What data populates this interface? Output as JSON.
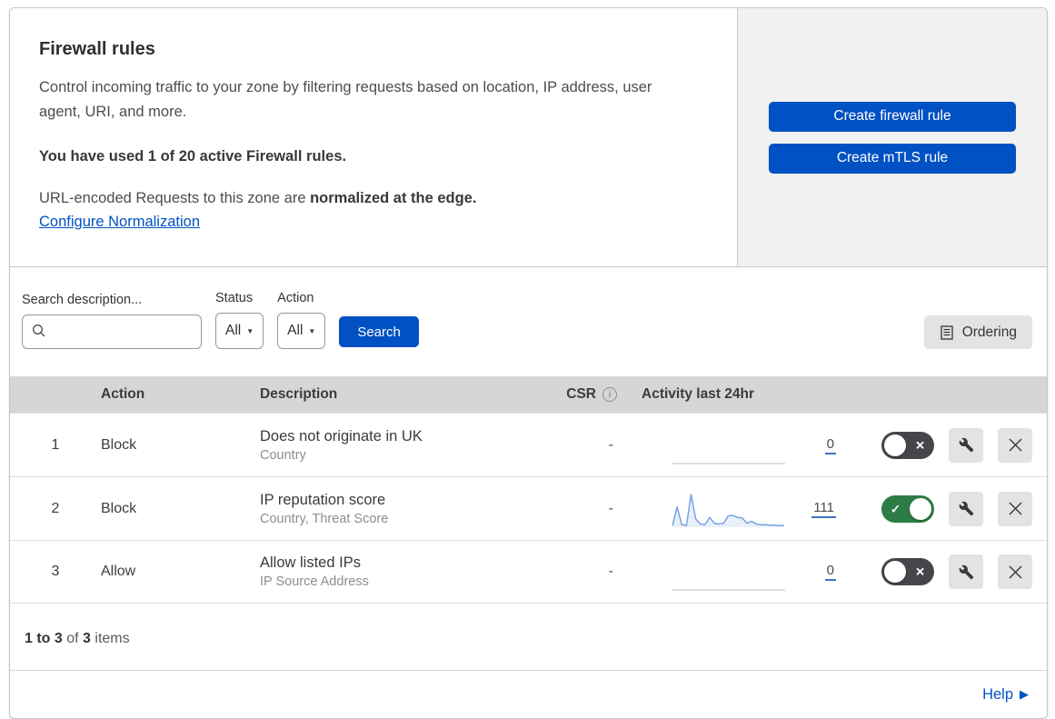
{
  "intro": {
    "title": "Firewall rules",
    "description": "Control incoming traffic to your zone by filtering requests based on location, IP address, user agent, URI, and more.",
    "usage": "You have used 1 of 20 active Firewall rules.",
    "normalization_prefix": "URL-encoded Requests to this zone are ",
    "normalization_bold": "normalized at the edge.",
    "normalization_link": "Configure Normalization"
  },
  "actions": {
    "create_firewall": "Create firewall rule",
    "create_mtls": "Create mTLS rule"
  },
  "filters": {
    "search_label": "Search description...",
    "search_value": "",
    "status_label": "Status",
    "status_value": "All",
    "action_label": "Action",
    "action_value": "All",
    "search_button": "Search",
    "ordering_button": "Ordering"
  },
  "table": {
    "headers": {
      "action": "Action",
      "description": "Description",
      "csr": "CSR",
      "activity": "Activity last 24hr"
    },
    "rows": [
      {
        "priority": "1",
        "action": "Block",
        "description": "Does not originate in UK",
        "fields": "Country",
        "csr": "-",
        "count": "0",
        "enabled": false,
        "sparkline": []
      },
      {
        "priority": "2",
        "action": "Block",
        "description": "IP reputation score",
        "fields": "Country, Threat Score",
        "csr": "-",
        "count": "111",
        "enabled": true,
        "sparkline": [
          5,
          62,
          8,
          5,
          100,
          25,
          10,
          8,
          30,
          12,
          10,
          12,
          35,
          36,
          30,
          28,
          12,
          18,
          10,
          7,
          8,
          6,
          6,
          5,
          5
        ]
      },
      {
        "priority": "3",
        "action": "Allow",
        "description": "Allow listed IPs",
        "fields": "IP Source Address",
        "csr": "-",
        "count": "0",
        "enabled": false,
        "sparkline": []
      }
    ]
  },
  "footer": {
    "range": "1 to 3",
    "of": " of ",
    "total": "3",
    "items": " items"
  },
  "help": {
    "label": "Help"
  },
  "icons": {
    "info": "i",
    "check": "✓",
    "x": "✕",
    "dropdown": "▼",
    "arrow_right": "▶"
  },
  "colors": {
    "primary_blue": "#0051c3",
    "toggle_on_green": "#2d7c45",
    "toggle_off_dark": "#45464b",
    "sparkline_blue": "#6e9fe1",
    "table_header_bg": "#d6d6d6",
    "panel_bg": "#f1f1f1"
  }
}
